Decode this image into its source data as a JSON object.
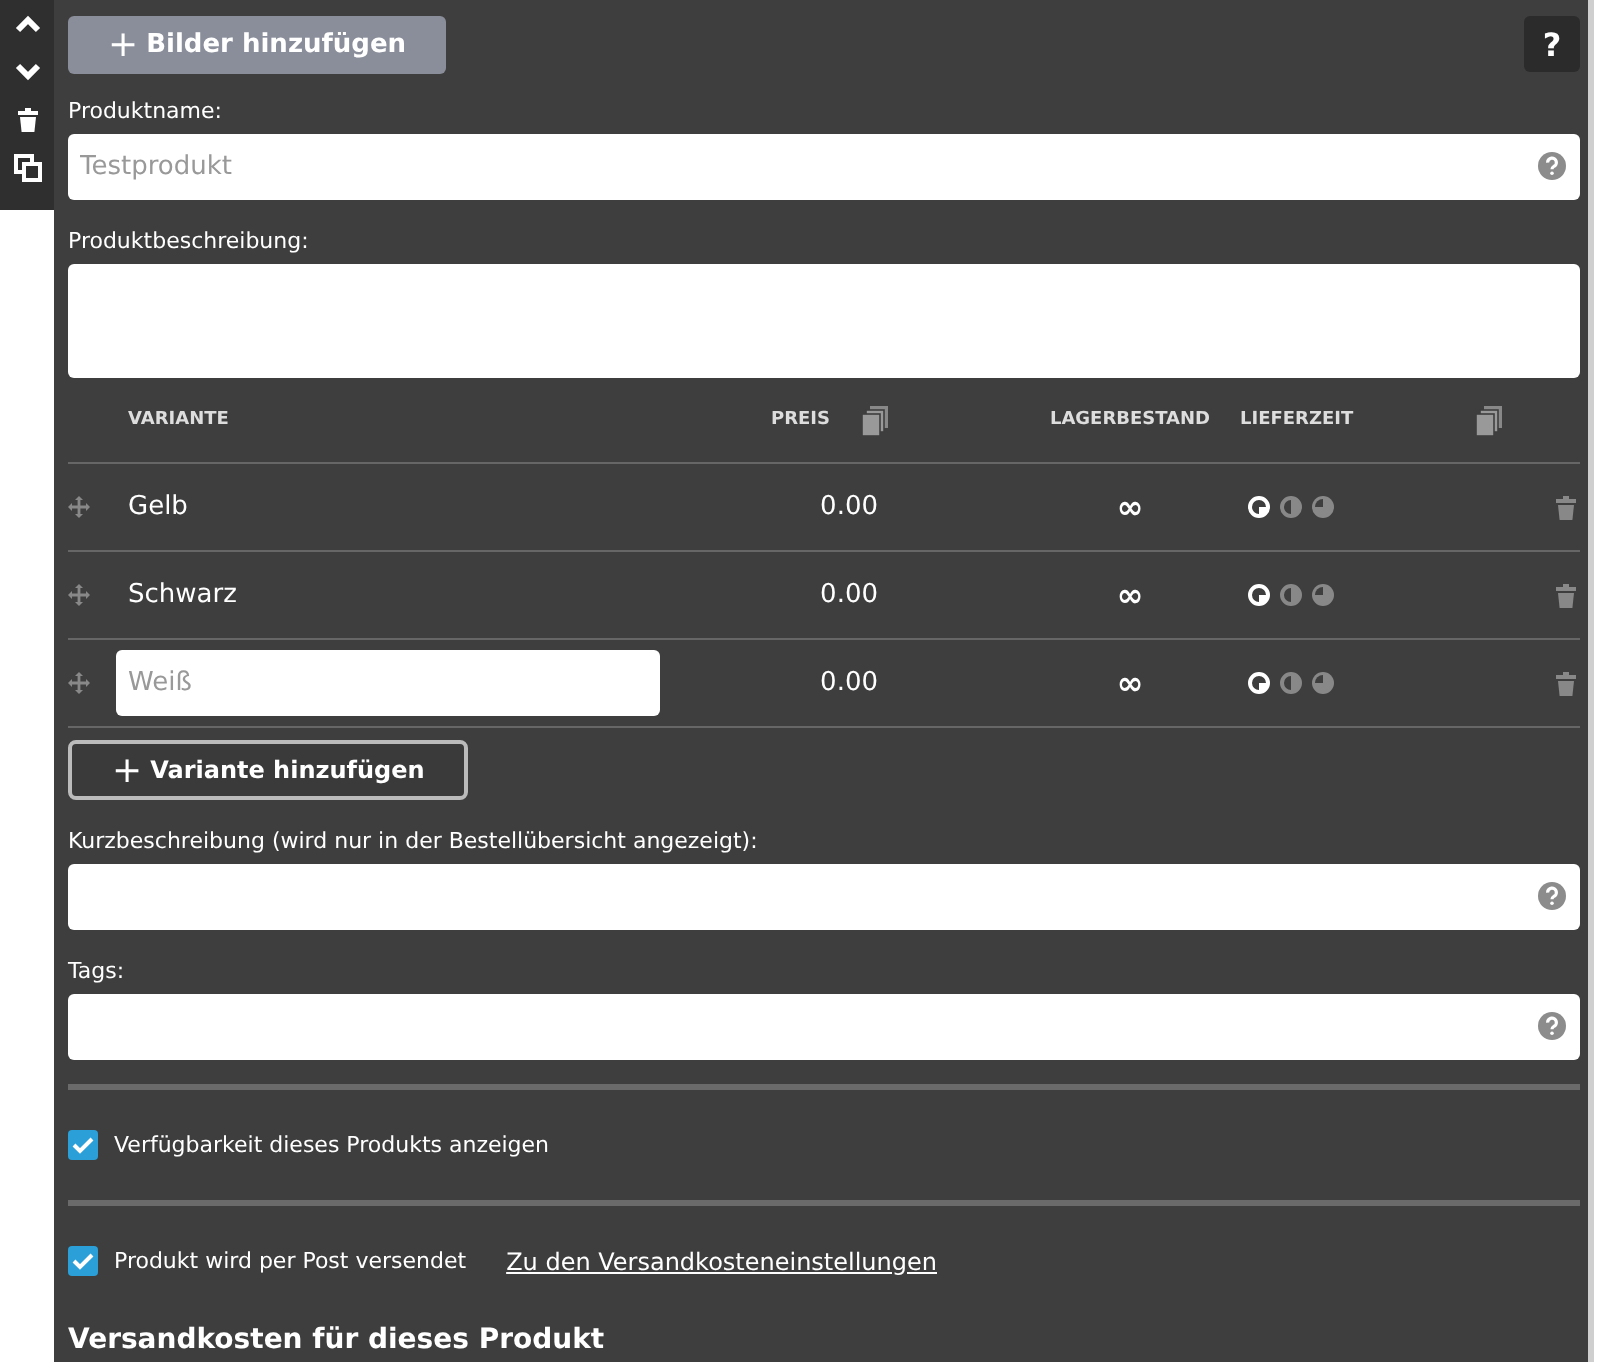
{
  "side_toolbar": {
    "buttons": [
      {
        "kind": "up"
      },
      {
        "kind": "down"
      },
      {
        "kind": "delete"
      },
      {
        "kind": "duplicate"
      }
    ]
  },
  "add_images_button": {
    "label": "Bilder hinzufügen",
    "icon": "+",
    "disabled": true
  },
  "help_button": {
    "label": "?"
  },
  "product_name": {
    "label": "Produktname:",
    "placeholder": "Testprodukt"
  },
  "product_description": {
    "label": "Produktbeschreibung:"
  },
  "variants_table": {
    "columns": [
      "VARIANTE",
      "PREIS",
      "LAGERBESTAND",
      "LIEFERZEIT"
    ],
    "rows": [
      {
        "kind": "text",
        "name": "Gelb",
        "price": "0.00",
        "stock": "∞",
        "delivery": [
          {
            "selected": true
          },
          {
            "selected": false
          },
          {
            "selected": false
          }
        ]
      },
      {
        "kind": "text",
        "name": "Schwarz",
        "price": "0.00",
        "stock": "∞",
        "delivery": [
          {
            "selected": true
          },
          {
            "selected": false
          },
          {
            "selected": false
          }
        ]
      },
      {
        "kind": "input",
        "placeholder": "Weiß",
        "price": "0.00",
        "stock": "∞",
        "delivery": [
          {
            "selected": true
          },
          {
            "selected": false
          },
          {
            "selected": false
          }
        ]
      }
    ]
  },
  "add_variant_button": {
    "label": "Variante hinzufügen",
    "icon": "+"
  },
  "short_description": {
    "label": "Kurzbeschreibung (wird nur in der Bestellübersicht angezeigt):"
  },
  "tags": {
    "label": "Tags:"
  },
  "show_availability": {
    "label": "Verfügbarkeit dieses Produkts anzeigen",
    "checked": true
  },
  "shipped_by_post": {
    "label": "Produkt wird per Post versendet",
    "checked": true,
    "link": "Zu den Versandkosteneinstellungen"
  },
  "shipping_heading": "Versandkosten für dieses Produkt"
}
